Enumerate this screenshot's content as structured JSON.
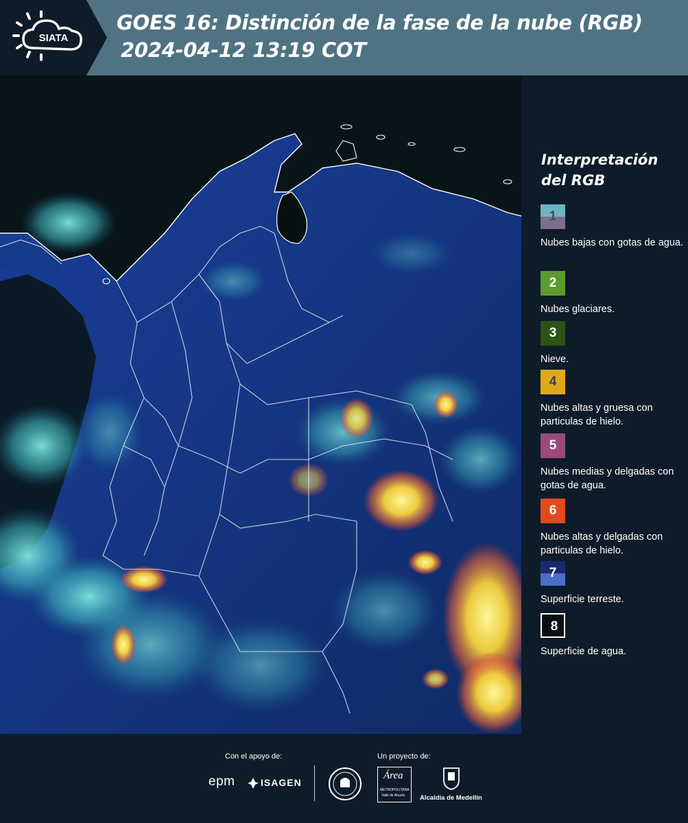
{
  "header": {
    "logo_text": "SIATA",
    "title_line1": "GOES 16: Distinción de la fase de la nube (RGB)",
    "title_line2": "2024-04-12 13:19 COT"
  },
  "legend": {
    "title_line1": "Interpretación",
    "title_line2": "del RGB",
    "items": [
      {
        "number": "1",
        "label": "Nubes bajas con gotas de agua.",
        "color_top": "#6fb3c4",
        "color_bottom": "#7b6f8d",
        "num_color": "#4a4a55"
      },
      {
        "number": "2",
        "label": "Nubes glaciares.",
        "color_top": "#5d9a2e",
        "color_bottom": "#5d9a2e",
        "num_color": "#ffffff"
      },
      {
        "number": "3",
        "label": "Nieve.",
        "color_top": "#2c5418",
        "color_bottom": "#2c5418",
        "num_color": "#ffffff"
      },
      {
        "number": "4",
        "label": "Nubes altas y gruesa con particulas de hielo.",
        "color_top": "#e0a91c",
        "color_bottom": "#e0a91c",
        "num_color": "#3a3a3a"
      },
      {
        "number": "5",
        "label": "Nubes medias y delgadas con gotas de agua.",
        "color_top": "#9b4a7a",
        "color_bottom": "#9b4a7a",
        "num_color": "#ffffff"
      },
      {
        "number": "6",
        "label": "Nubes altas y delgadas con particulas de hielo.",
        "color_top": "#e04a1e",
        "color_bottom": "#e04a1e",
        "num_color": "#ffffff"
      },
      {
        "number": "7",
        "label": "Superficie terreste.",
        "color_top": "#1a2a6e",
        "color_bottom": "#4a6fc8",
        "num_color": "#ffffff"
      },
      {
        "number": "8",
        "label": "Superficie de agua.",
        "color_top": "#061010",
        "color_bottom": "#061010",
        "num_color": "#ffffff"
      }
    ]
  },
  "footer": {
    "support_caption": "Con el apoyo de:",
    "project_caption": "Un proyecto de:",
    "brand_epm": "epm",
    "brand_isagen": "ISAGEN",
    "brand_area_line1": "Área",
    "brand_area_line2": "METROPOLITANA",
    "brand_area_line3": "Valle de Aburrá",
    "brand_alcaldia": "Alcaldía de Medellín"
  },
  "colors": {
    "header_bg": "#4f7383",
    "logo_bg": "#0d1c28",
    "panel_bg": "#0d1c28",
    "ocean": "#071418",
    "land": "#183a8a",
    "cloud_cyan": "#5fd6d0",
    "cloud_yellow": "#f3e04a"
  }
}
